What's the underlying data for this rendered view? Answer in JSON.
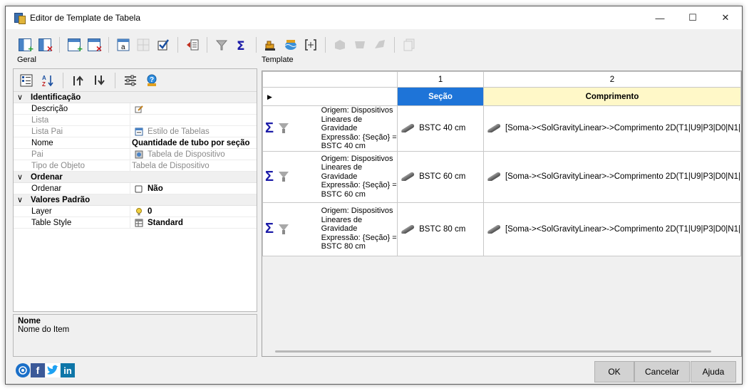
{
  "window": {
    "title": "Editor de Template de Tabela",
    "controls": [
      "—",
      "☐",
      "✕"
    ]
  },
  "labels": {
    "left_section": "Geral",
    "right_section": "Template"
  },
  "properties": {
    "categories": [
      {
        "name": "Identificação",
        "rows": [
          {
            "name": "Descrição",
            "value": "",
            "name_muted": false,
            "value_muted": false,
            "value_bold": false,
            "icon": "edit-icon"
          },
          {
            "name": "Lista",
            "value": "",
            "name_muted": true,
            "value_muted": false,
            "value_bold": false,
            "icon": ""
          },
          {
            "name": "Lista Pai",
            "value": "Estilo de Tabelas",
            "name_muted": true,
            "value_muted": true,
            "value_bold": false,
            "icon": "list-icon"
          },
          {
            "name": "Nome",
            "value": "Quantidade de tubo por seção",
            "name_muted": false,
            "value_muted": false,
            "value_bold": true,
            "icon": ""
          },
          {
            "name": "Pai",
            "value": "Tabela de Dispositivo",
            "name_muted": true,
            "value_muted": true,
            "value_bold": false,
            "icon": "device-icon"
          },
          {
            "name": "Tipo de Objeto",
            "value": "Tabela de Dispositivo",
            "name_muted": true,
            "value_muted": true,
            "value_bold": false,
            "icon": ""
          }
        ]
      },
      {
        "name": "Ordenar",
        "rows": [
          {
            "name": "Ordenar",
            "value": "Não",
            "name_muted": false,
            "value_muted": false,
            "value_bold": true,
            "icon": "checkbox-icon"
          }
        ]
      },
      {
        "name": "Valores Padrão",
        "rows": [
          {
            "name": "Layer",
            "value": "0",
            "name_muted": false,
            "value_muted": false,
            "value_bold": true,
            "icon": "bulb-icon"
          },
          {
            "name": "Table Style",
            "value": "Standard",
            "name_muted": false,
            "value_muted": false,
            "value_bold": true,
            "icon": "table-icon"
          }
        ]
      }
    ]
  },
  "description_box": {
    "title": "Nome",
    "text": "Nome do Item"
  },
  "template": {
    "column_numbers": [
      "",
      "1",
      "2"
    ],
    "header_cells": [
      "",
      "Seção",
      "Comprimento"
    ],
    "rows": [
      {
        "origin": "Origem: Dispositivos Lineares de Gravidade Expressão: {Seção} = BSTC 40 cm",
        "origin_lines": [
          "Origem: Dispositivos",
          "Lineares de Gravidade",
          "Expressão: {Seção} =",
          "BSTC 40 cm"
        ],
        "section": "BSTC 40 cm",
        "length": "[Soma-><SolGravityLinear>->Comprimento 2D(T1|U9|P3|D0|N1|"
      },
      {
        "origin": "Origem: Dispositivos Lineares de Gravidade Expressão: {Seção} = BSTC 60 cm",
        "origin_lines": [
          "Origem: Dispositivos",
          "Lineares de Gravidade",
          "Expressão: {Seção} =",
          "BSTC 60 cm"
        ],
        "section": "BSTC 60 cm",
        "length": "[Soma-><SolGravityLinear>->Comprimento 2D(T1|U9|P3|D0|N1|"
      },
      {
        "origin": "Origem: Dispositivos Lineares de Gravidade Expressão: {Seção} = BSTC 80 cm",
        "origin_lines": [
          "Origem: Dispositivos",
          "Lineares de Gravidade",
          "Expressão: {Seção} =",
          "BSTC 80 cm"
        ],
        "section": "BSTC 80 cm",
        "length": "[Soma-><SolGravityLinear>->Comprimento 2D(T1|U9|P3|D0|N1|"
      }
    ]
  },
  "footer": {
    "ok": "OK",
    "cancel": "Cancelar",
    "help": "Ajuda",
    "social": [
      "website-icon",
      "facebook-icon",
      "twitter-icon",
      "linkedin-icon"
    ]
  },
  "colors": {
    "section_header": "#1e74d8",
    "length_header": "#fff8c8",
    "sigma": "#1c1ca8"
  }
}
